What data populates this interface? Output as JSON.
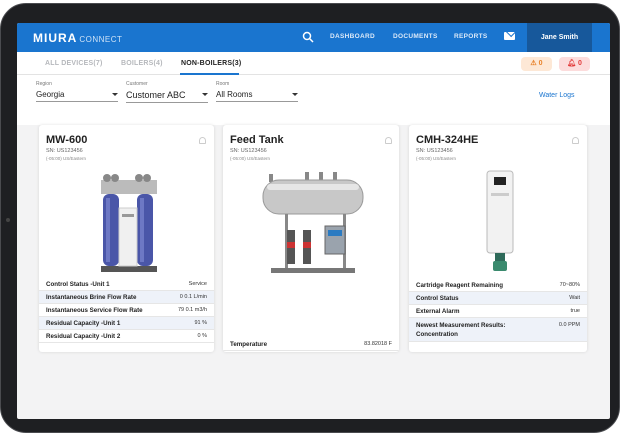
{
  "header": {
    "brand": "MIURA",
    "brand_sub": "CONNECT",
    "nav": [
      "DASHBOARD",
      "DOCUMENTS",
      "REPORTS"
    ],
    "user": "Jane Smith"
  },
  "tabs": [
    {
      "label": "ALL DEVICES(7)"
    },
    {
      "label": "BOILERS(4)"
    },
    {
      "label": "NON-BOILERS(3)"
    }
  ],
  "alerts": {
    "warning_count": "0",
    "critical_count": "0"
  },
  "filters": {
    "region": {
      "label": "Region",
      "value": "Georgia"
    },
    "customer": {
      "label": "Customer",
      "value": "Customer ABC"
    },
    "room": {
      "label": "Room",
      "value": "All Rooms"
    },
    "water_logs": "Water Logs"
  },
  "cards": [
    {
      "title": "MW-600",
      "sn": "SN: US123456",
      "tz": "(-05:00) US/Eastern",
      "rows": [
        {
          "k": "Control Status -Unit 1",
          "v": "Service"
        },
        {
          "k": "Instantaneous Brine Flow Rate",
          "v": "0 0.1 L/min"
        },
        {
          "k": "Instantaneous Service Flow Rate",
          "v": "79 0.1 m3/h"
        },
        {
          "k": "Residual Capacity -Unit 1",
          "v": "91 %"
        },
        {
          "k": "Residual Capacity -Unit 2",
          "v": "0 %"
        }
      ]
    },
    {
      "title": "Feed Tank",
      "sn": "SN: US123456",
      "tz": "(-05:00) US/Eastern",
      "rows": [
        {
          "k": "Temperature",
          "v": "83.82018 F"
        }
      ]
    },
    {
      "title": "CMH-324HE",
      "sn": "SN: US123456",
      "tz": "(-05:00) US/Eastern",
      "rows": [
        {
          "k": "Cartridge Reagent Remaining",
          "v": "70~80%"
        },
        {
          "k": "Control Status",
          "v": "Wait"
        },
        {
          "k": "External Alarm",
          "v": "true"
        },
        {
          "k": "Newest Measurement Results: Concentration",
          "v": "0.0 PPM"
        }
      ]
    }
  ],
  "colors": {
    "primary": "#1a75cf",
    "warning": "#e8822a",
    "critical": "#e23b3b"
  }
}
